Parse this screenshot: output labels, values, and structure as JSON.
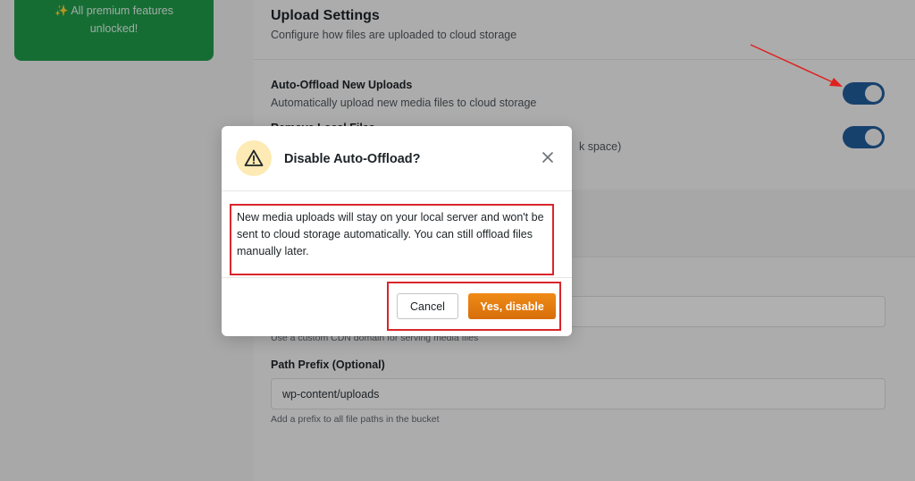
{
  "sidebar": {
    "premium_line1": "✨ All premium features",
    "premium_line2": "unlocked!",
    "accent": "#1f9d4b"
  },
  "upload_settings": {
    "title": "Upload Settings",
    "subtitle": "Configure how files are uploaded to cloud storage",
    "auto_offload": {
      "title": "Auto-Offload New Uploads",
      "description": "Automatically upload new media files to cloud storage",
      "enabled": true
    },
    "second_toggle": {
      "title_partial": "Remove Local Files",
      "description_partial": "k space)",
      "enabled": true
    },
    "toggle_color": "#215e9c"
  },
  "cdn": {
    "help": "Use a custom CDN domain for serving media files"
  },
  "path_prefix": {
    "label": "Path Prefix (Optional)",
    "value": "wp-content/uploads",
    "help": "Add a prefix to all file paths in the bucket"
  },
  "dialog": {
    "title": "Disable Auto-Offload?",
    "icon": "warning-icon",
    "close_icon": "close-icon",
    "message": "New media uploads will stay on your local server and won't be sent to cloud storage automatically. You can still offload files manually later.",
    "cancel_label": "Cancel",
    "confirm_label": "Yes, disable",
    "confirm_color": "#e07a10",
    "warning_bg": "#fdeab4"
  },
  "annotations": {
    "highlight_color": "#d8262c"
  }
}
